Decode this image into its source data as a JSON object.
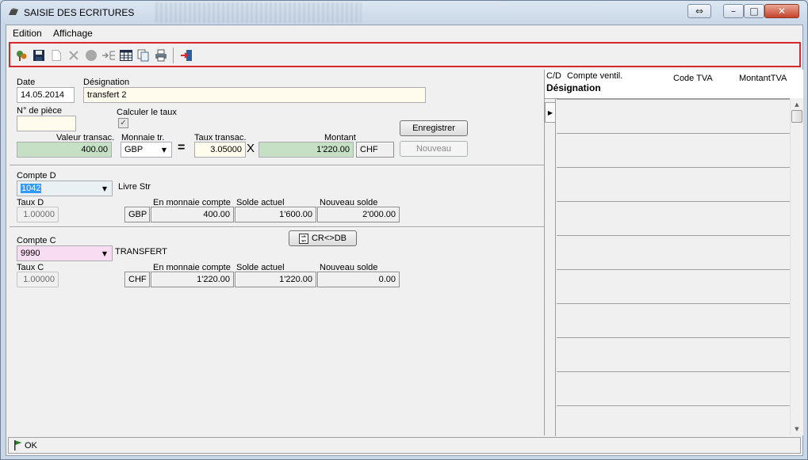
{
  "window": {
    "title": "SAISIE DES ECRITURES",
    "controls": {
      "restore_arrows": "⇔",
      "minimize": "–",
      "maximize": "□",
      "close": "✕"
    }
  },
  "menu": {
    "edition": "Edition",
    "affichage": "Affichage"
  },
  "toolbar": {
    "icons": [
      "tree-icon",
      "save-icon",
      "new-document-icon",
      "delete-icon",
      "record-icon",
      "indent-icon",
      "table-icon",
      "copy-icon",
      "print-icon",
      "exit-icon"
    ]
  },
  "form": {
    "date_label": "Date",
    "date_value": "14.05.2014",
    "designation_label": "Désignation",
    "designation_value": "transfert 2",
    "piece_label": "N° de pièce",
    "piece_value": "",
    "calc_rate_label": "Calculer le taux",
    "calc_rate_checked": "✓",
    "valeur_label": "Valeur transac.",
    "valeur_value": "400.00",
    "monnaie_label": "Monnaie tr.",
    "monnaie_value": "GBP",
    "equals": "=",
    "taux_label": "Taux transac.",
    "taux_value": "3.05000",
    "times": "X",
    "montant_label": "Montant",
    "montant_value": "1'220.00",
    "montant_currency": "CHF",
    "save_button": "Enregistrer",
    "new_button": "Nouveau"
  },
  "compte_d": {
    "label": "Compte D",
    "value": "1042",
    "name": "Livre Str",
    "taux_label": "Taux D",
    "taux_value": "1.00000",
    "currency": "GBP",
    "en_monnaie_label": "En monnaie compte",
    "en_monnaie_value": "400.00",
    "solde_actuel_label": "Solde actuel",
    "solde_actuel_value": "1'600.00",
    "nouveau_solde_label": "Nouveau solde",
    "nouveau_solde_value": "2'000.00"
  },
  "swap_button": "CR<>DB",
  "compte_c": {
    "label": "Compte C",
    "value": "9990",
    "name": "TRANSFERT",
    "taux_label": "Taux C",
    "taux_value": "1.00000",
    "currency": "CHF",
    "en_monnaie_label": "En monnaie compte",
    "en_monnaie_value": "1'220.00",
    "solde_actuel_label": "Solde actuel",
    "solde_actuel_value": "1'220.00",
    "nouveau_solde_label": "Nouveau solde",
    "nouveau_solde_value": "0.00"
  },
  "grid": {
    "col_cd": "C/D",
    "col_compte_ventil": "Compte ventil.",
    "col_code_tva": "Code TVA",
    "col_montant_tva": "MontantTVA",
    "col_designation": "Désignation"
  },
  "status": {
    "text": "OK"
  },
  "colors": {
    "highlight_border": "#d8282f",
    "green_field": "#c5e0c4",
    "pink_field": "#f8dcf2",
    "cream_field": "#fffcee"
  }
}
